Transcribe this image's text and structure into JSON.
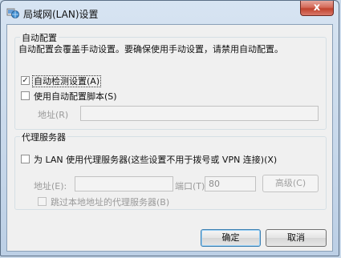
{
  "window": {
    "title": "局域网(LAN)设置",
    "close_label": "x"
  },
  "auto_config": {
    "group_label": "自动配置",
    "description": "自动配置会覆盖手动设置。要确保使用手动设置，请禁用自动配置。",
    "auto_detect": {
      "label": "自动检测设置(A)",
      "checked": true
    },
    "use_script": {
      "label": "使用自动配置脚本(S)",
      "checked": false
    },
    "address_label": "地址(R)",
    "address_value": ""
  },
  "proxy": {
    "group_label": "代理服务器",
    "use_proxy": {
      "label": "为 LAN 使用代理服务器(这些设置不用于拨号或 VPN 连接)(X)",
      "checked": false
    },
    "address_label": "地址(E):",
    "address_value": "",
    "port_label": "端口(T):",
    "port_value": "80",
    "advanced_label": "高级(C)",
    "bypass_local": {
      "label": "跳过本地地址的代理服务器(B)",
      "checked": false
    }
  },
  "buttons": {
    "ok_label": "确定",
    "cancel_label": "取消"
  },
  "colors": {
    "title_bar": "#c9d9ea",
    "close_button": "#c0432e",
    "dialog_bg": "#f0f0f0",
    "default_button_border": "#3c7fb1"
  }
}
